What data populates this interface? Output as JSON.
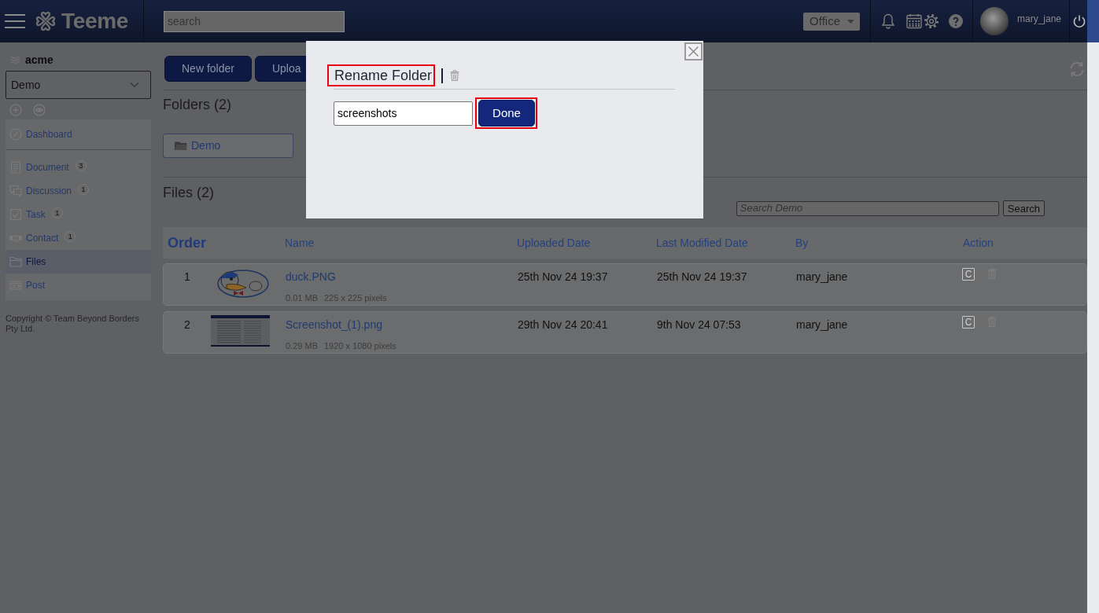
{
  "topbar": {
    "logo_text": "Teeme",
    "search": {
      "placeholder": "search"
    },
    "workspace_menu": "Office",
    "user_name": "mary_jane"
  },
  "sidebar": {
    "org_name": "acme",
    "space_select": {
      "value": "Demo"
    },
    "menu_groups": [
      {
        "items": [
          {
            "label": "Dashboard",
            "selected": false
          }
        ]
      },
      {
        "items": [
          {
            "label": "Document",
            "badge": "3",
            "selected": false
          },
          {
            "label": "Discussion",
            "badge": "1",
            "selected": false
          },
          {
            "label": "Task",
            "badge": "1",
            "selected": false
          },
          {
            "label": "Contact",
            "badge": "1",
            "selected": false
          },
          {
            "label": "Files",
            "selected": true
          },
          {
            "label": "Post",
            "selected": false
          }
        ]
      }
    ],
    "copyright": "Copyright © Team Beyond Borders Pty Ltd."
  },
  "toolbar": {
    "buttons": [
      "New folder",
      "Uploa"
    ]
  },
  "folders": {
    "title": "Folders (2)",
    "items": [
      {
        "name": "Demo"
      }
    ]
  },
  "files": {
    "title": "Files (2)",
    "search": {
      "placeholder": "Search Demo"
    },
    "search_button": "Search",
    "columns": [
      "Order",
      "Name",
      "Uploaded Date",
      "Last Modified Date",
      "By",
      "Action"
    ],
    "rows": [
      {
        "kind": "cartoon",
        "order": "1",
        "name": "duck.PNG",
        "size": "0.01 MB",
        "dimensions": "225 x 225 pixels",
        "uploaded": "25th Nov 24 19:37",
        "modified": "25th Nov 24 19:37",
        "by": "mary_jane",
        "action_button": "C"
      },
      {
        "kind": "screenshot",
        "order": "2",
        "name": "Screenshot_(1).png",
        "size": "0.29 MB",
        "dimensions": "1920 x 1080 pixels",
        "uploaded": "29th Nov 24 20:41",
        "modified": "9th Nov 24 07:53",
        "by": "mary_jane",
        "action_button": "C"
      }
    ]
  },
  "dialog": {
    "title": "Rename Folder",
    "title_highlighted": true,
    "folder_name": "screenshots",
    "done_button": "Done",
    "done_highlighted": true
  }
}
